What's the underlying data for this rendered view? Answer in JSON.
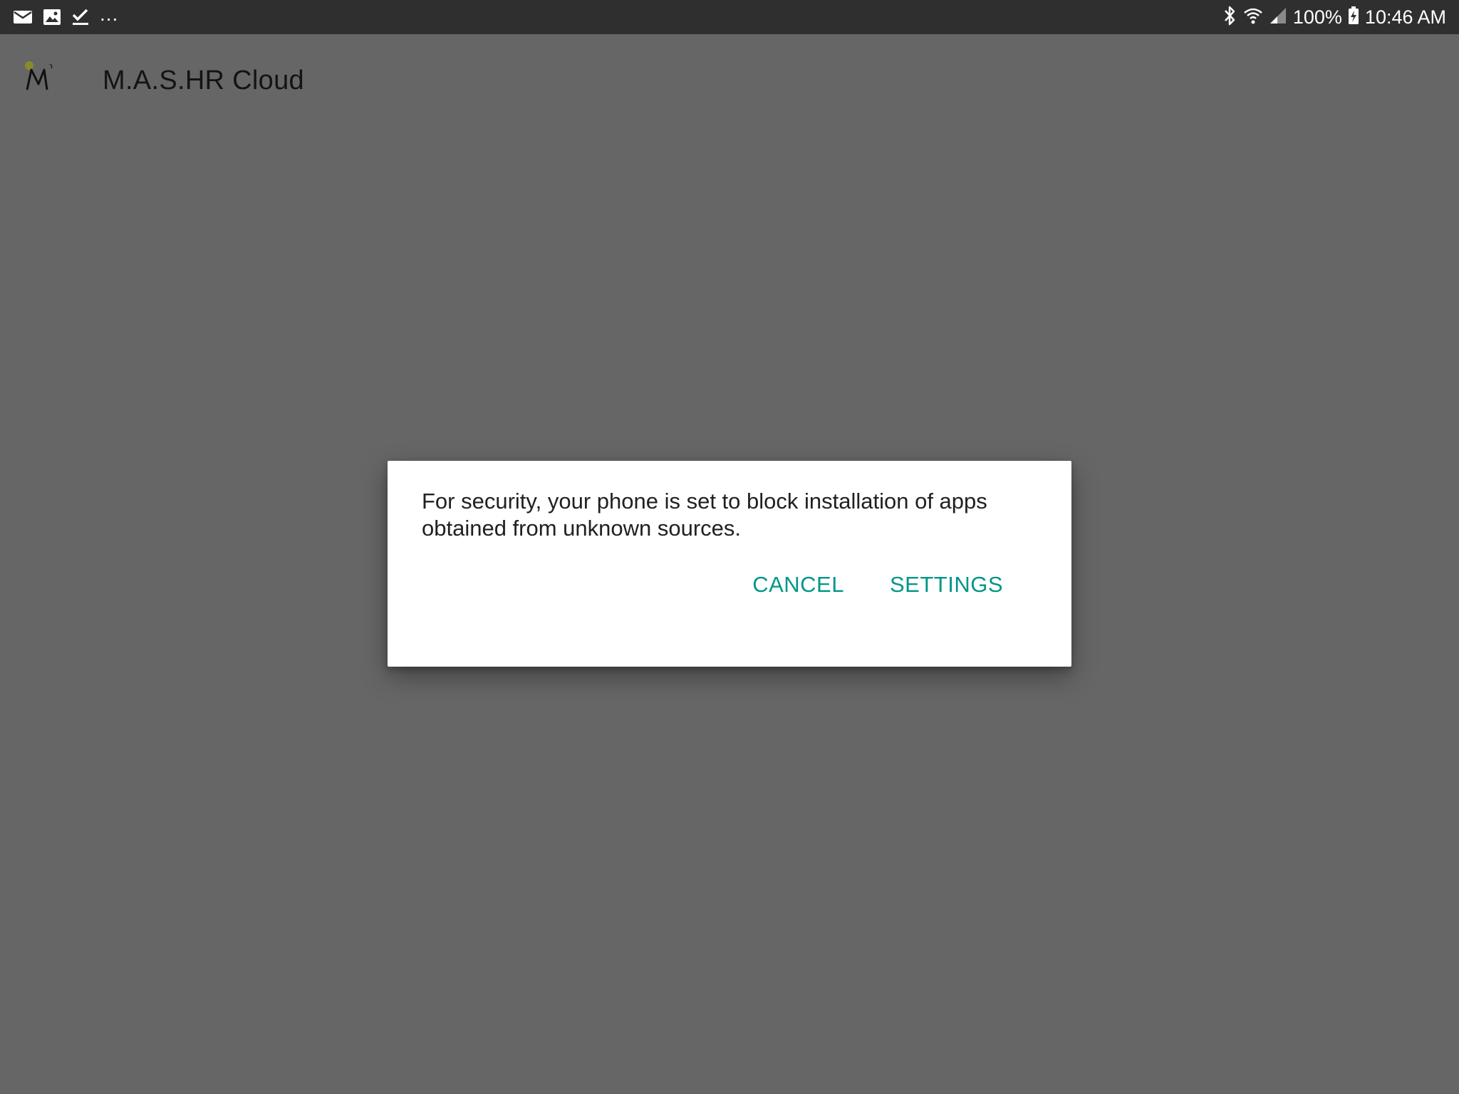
{
  "status_bar": {
    "left_icons": [
      "mail-icon",
      "gallery-icon",
      "checkmark-icon"
    ],
    "overflow": "...",
    "right_icons": [
      "bluetooth-icon",
      "wifi-icon",
      "cell-signal-icon"
    ],
    "battery_text": "100%",
    "battery_icon": "battery-charging-icon",
    "time": "10:46 AM"
  },
  "app_bar": {
    "logo_icon": "app-logo-icon",
    "title": "M.A.S.HR Cloud"
  },
  "dialog": {
    "message": "For security, your phone is set to block installation of apps obtained from unknown sources.",
    "cancel_label": "CANCEL",
    "settings_label": "SETTINGS",
    "accent_color": "#009688"
  }
}
